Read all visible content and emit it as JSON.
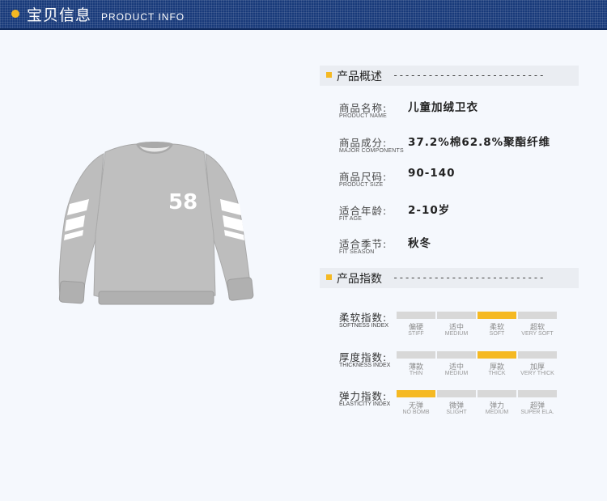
{
  "header": {
    "title": "宝贝信息",
    "subtitle": "PRODUCT INFO"
  },
  "product_image": {
    "number": "58"
  },
  "overview": {
    "title": "产品概述",
    "dashes": "--------------------------",
    "rows": [
      {
        "label": "商品名称:",
        "sub": "PRODUCT NAME",
        "value": "儿童加绒卫衣"
      },
      {
        "label": "商品成分:",
        "sub": "MAJOR COMPONENTS",
        "value": "37.2%棉62.8%聚酯纤维"
      },
      {
        "label": "商品尺码:",
        "sub": "PRODUCT SIZE",
        "value": "90-140"
      },
      {
        "label": "适合年龄:",
        "sub": "FIT AGE",
        "value": "2-10岁"
      },
      {
        "label": "适合季节:",
        "sub": "FIT SEASON",
        "value": "秋冬"
      }
    ]
  },
  "indices": {
    "title": "产品指数",
    "dashes": "--------------------------",
    "rows": [
      {
        "label": "柔软指数:",
        "sub": "SOFTNESS INDEX",
        "active": 2,
        "options": [
          {
            "cn": "偏硬",
            "en": "STIFF"
          },
          {
            "cn": "适中",
            "en": "MEDIUM"
          },
          {
            "cn": "柔软",
            "en": "SOFT"
          },
          {
            "cn": "超软",
            "en": "VERY SOFT"
          }
        ]
      },
      {
        "label": "厚度指数:",
        "sub": "THICKNESS INDEX",
        "active": 2,
        "options": [
          {
            "cn": "薄款",
            "en": "THIN"
          },
          {
            "cn": "适中",
            "en": "MEDIUM"
          },
          {
            "cn": "厚款",
            "en": "THICK"
          },
          {
            "cn": "加厚",
            "en": "VERY THICK"
          }
        ]
      },
      {
        "label": "弹力指数:",
        "sub": "ELASTICITY INDEX",
        "active": 0,
        "options": [
          {
            "cn": "无弹",
            "en": "NO BOMB"
          },
          {
            "cn": "微弹",
            "en": "SLIGHT"
          },
          {
            "cn": "弹力",
            "en": "MEDIUM"
          },
          {
            "cn": "超弹",
            "en": "SUPER ELA."
          }
        ]
      }
    ]
  },
  "colors": {
    "header_bg": "#183a7a",
    "accent": "#f5b923",
    "inactive_segment": "#d8d8d8",
    "sweater": "#bdbdbd"
  }
}
